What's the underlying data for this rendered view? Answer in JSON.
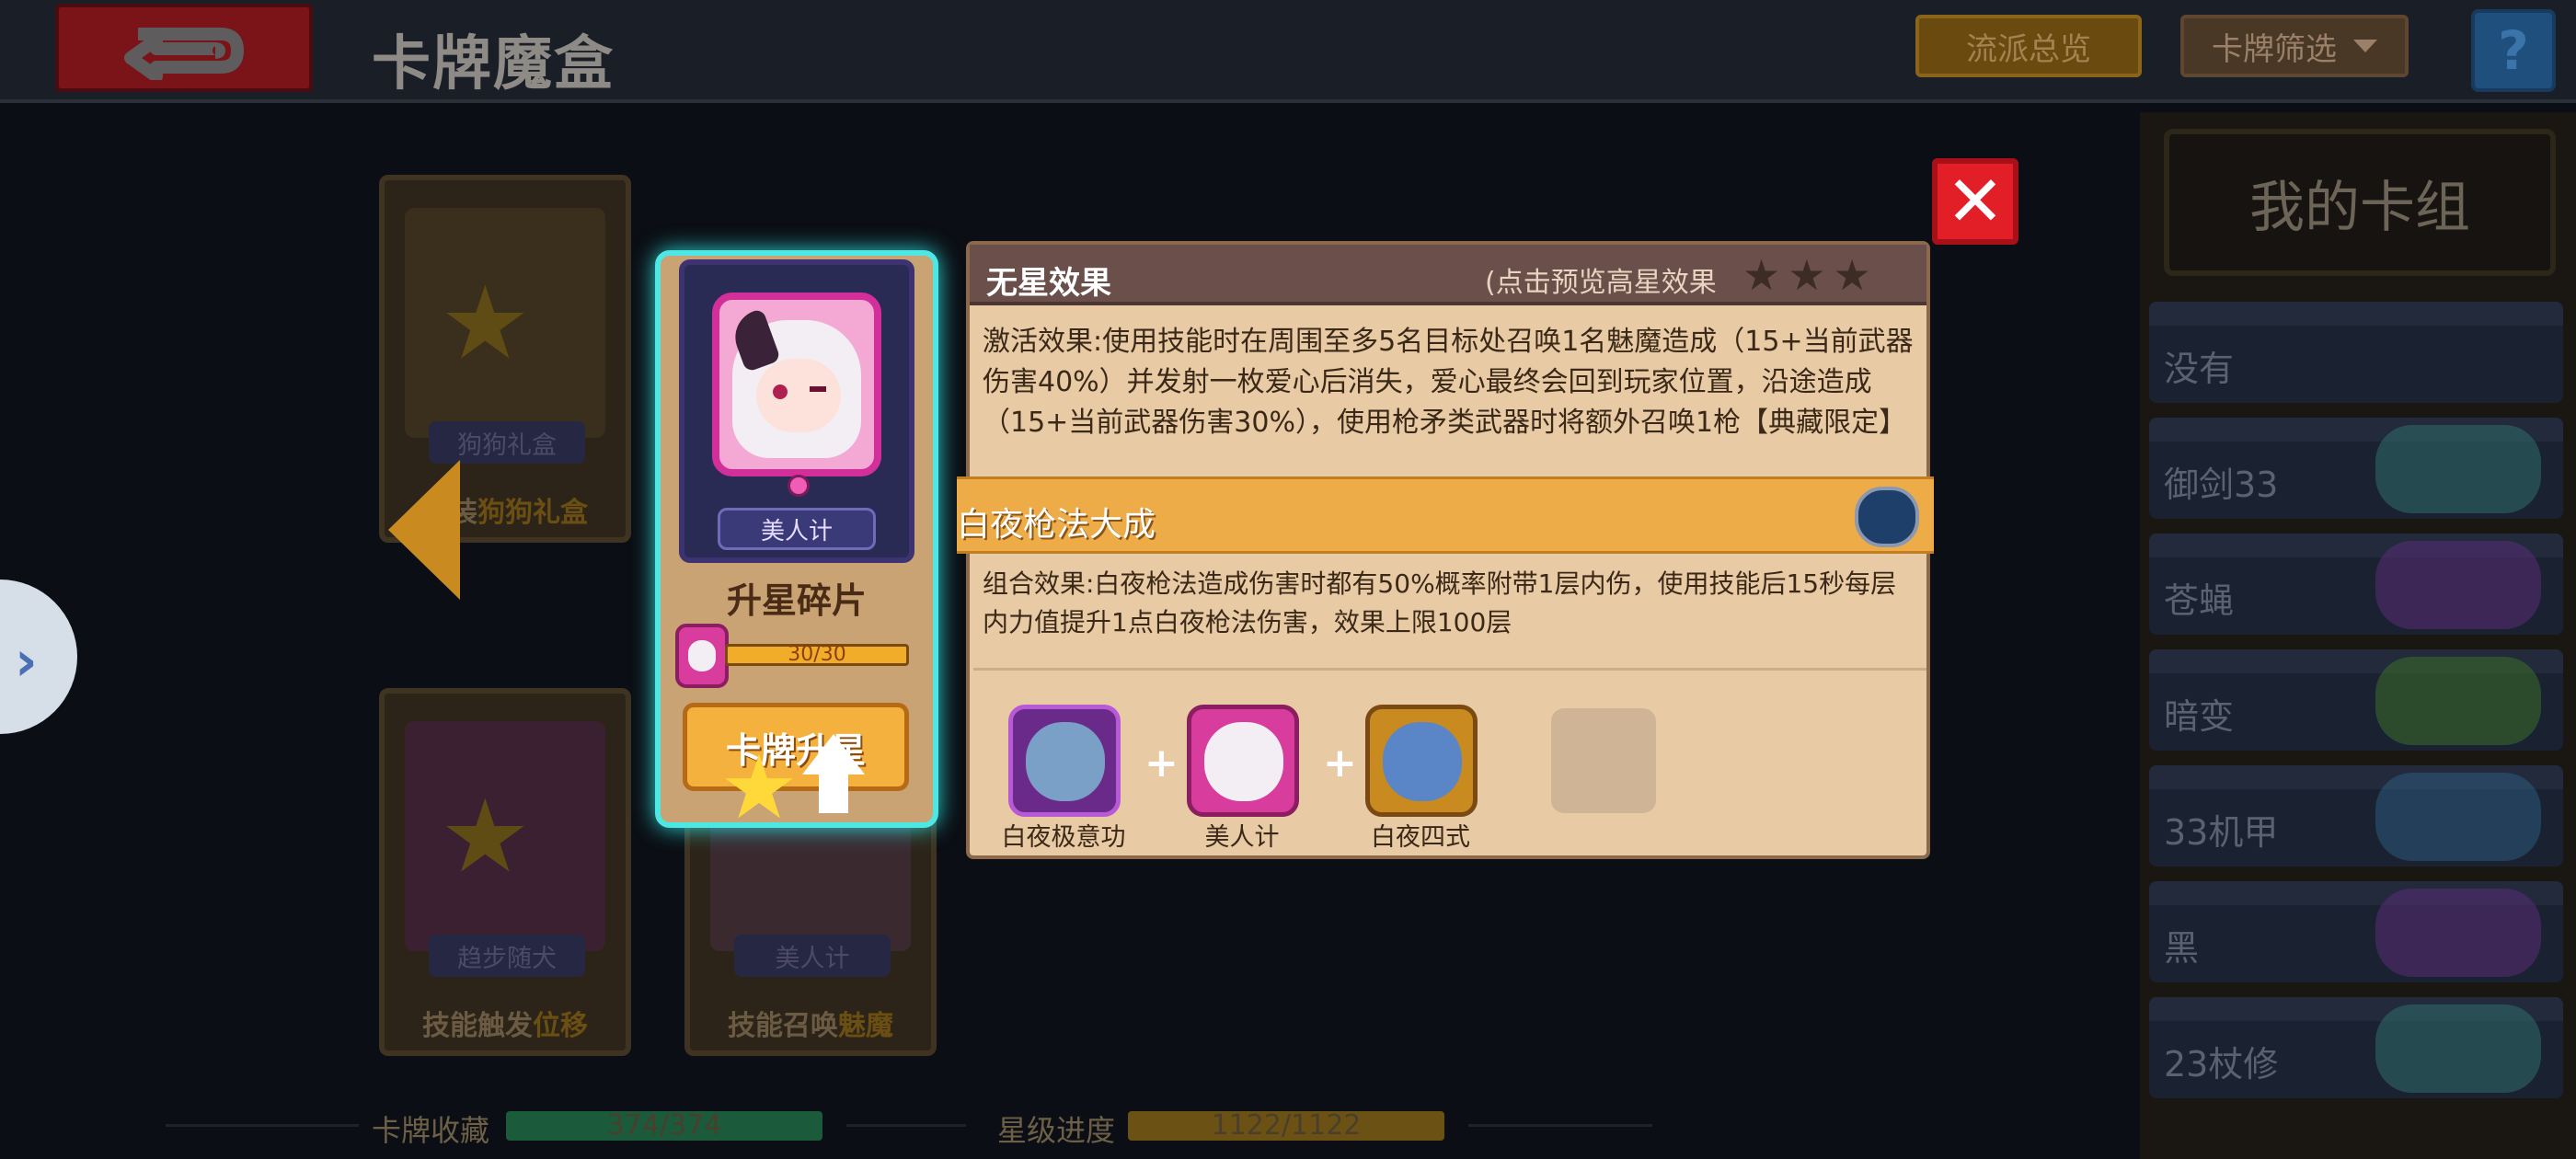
{
  "header": {
    "title": "卡牌魔盒",
    "school_overview": "流派总览",
    "card_filter": "卡牌筛选",
    "help": "?"
  },
  "background_cards": [
    {
      "name": "狗狗礼盒",
      "desc_pre": "安装",
      "desc_hl": "狗狗礼盒"
    },
    {
      "name": "趋步随犬",
      "desc_pre": "技能触发",
      "desc_hl": "位移"
    },
    {
      "name": "美人计",
      "desc_pre": "技能召唤",
      "desc_hl": "魅魔"
    }
  ],
  "stats": {
    "collection_label": "卡牌收藏",
    "collection_value": "374/374",
    "collection_ratio": 1.0,
    "star_label": "星级进度",
    "star_value": "1122/1122",
    "star_ratio": 1.0
  },
  "deck": {
    "title": "我的卡组",
    "items": [
      {
        "label": "没有"
      },
      {
        "label": "御剑33"
      },
      {
        "label": "苍蝇"
      },
      {
        "label": "暗变"
      },
      {
        "label": "33机甲"
      },
      {
        "label": "黑"
      },
      {
        "label": "23杖修"
      }
    ]
  },
  "selected_card": {
    "name": "美人计",
    "shard_title": "升星碎片",
    "shard_progress": "30/30",
    "shard_ratio": 1.0,
    "upgrade_button": "卡牌升星"
  },
  "detail": {
    "star_title": "无星效果",
    "preview_hint": "(点击预览高星效果",
    "stars_shown": 3,
    "effect_text": "激活效果:使用技能时在周围至多5名目标处召唤1名魅魔造成（15+当前武器伤害40%）并发射一枚爱心后消失，爱心最终会回到玩家位置，沿途造成（15+当前武器伤害30%），使用枪矛类武器时将额外召唤1枪【典藏限定】",
    "combo_name": "白夜枪法大成",
    "combo_text": "组合效果:白夜枪法造成伤害时都有50%概率附带1层内伤，使用技能后15秒每层内力值提升1点白夜枪法伤害，效果上限100层",
    "combo_cards": [
      {
        "label": "白夜极意功",
        "icon": "yin-yang-icon"
      },
      {
        "label": "美人计",
        "icon": "succubus-icon"
      },
      {
        "label": "白夜四式",
        "icon": "spear-wings-icon"
      }
    ],
    "plus": "+",
    "close": "✕"
  },
  "colors": {
    "accent_cyan": "#4fe7e4",
    "gold": "#f4b13d",
    "panel_bg": "#e8caa4",
    "header_brown": "#6a4f4a",
    "close_red": "#e21f27"
  }
}
